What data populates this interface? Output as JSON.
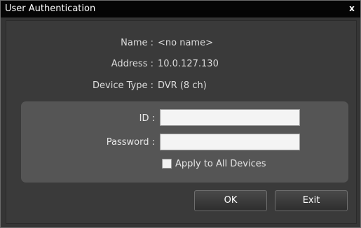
{
  "window": {
    "title": "User Authentication",
    "close_symbol": "x"
  },
  "device_info": {
    "name_label": "Name :",
    "name_value": "<no name>",
    "address_label": "Address :",
    "address_value": "10.0.127.130",
    "device_type_label": "Device Type :",
    "device_type_value": "DVR (8 ch)"
  },
  "login": {
    "id_label": "ID :",
    "id_value": "",
    "password_label": "Password :",
    "password_value": "",
    "apply_all_label": "Apply to All Devices",
    "apply_all_checked": false
  },
  "buttons": {
    "ok_label": "OK",
    "exit_label": "Exit"
  },
  "colors": {
    "titlebar": "#050505",
    "background": "#353535",
    "panel": "#555555",
    "text": "#dcdcdc"
  },
  "icons": {
    "close": "close-icon"
  }
}
